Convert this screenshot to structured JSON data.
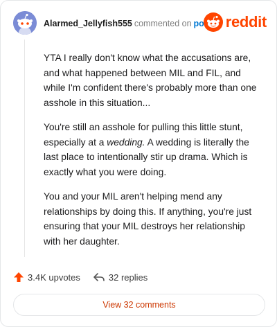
{
  "header": {
    "username": "Alarmed_Jellyfish555",
    "commented": "commented on",
    "post_link": "post",
    "logo_text": "reddit"
  },
  "comment": {
    "paragraphs": [
      "YTA I really don't know what the accusations are, and what happened between MIL and FIL, and while I'm confident there's probably more than one asshole in this situation...",
      "You and your MIL aren't helping mend any relationships by doing this. If anything, you're just ensuring that your MIL destroys her relationship with her daughter."
    ],
    "p2": {
      "before": "You're still an asshole for pulling this little stunt, especially at a ",
      "emphasis": "wedding.",
      "after": " A wedding is literally the last place to intentionally stir up drama. Which is exactly what you were doing."
    }
  },
  "stats": {
    "upvotes": "3.4K upvotes",
    "replies": "32 replies"
  },
  "footer": {
    "view_comments": "View 32 comments"
  },
  "colors": {
    "brand": "#ff4500",
    "link": "#0079d3",
    "avatar": "#7b8cd6",
    "button_text": "#cc3700"
  },
  "icons": {
    "avatar": "snoo-avatar-icon",
    "logo": "reddit-logo-icon",
    "upvote": "upvote-arrow-icon",
    "reply": "reply-arrow-icon"
  }
}
